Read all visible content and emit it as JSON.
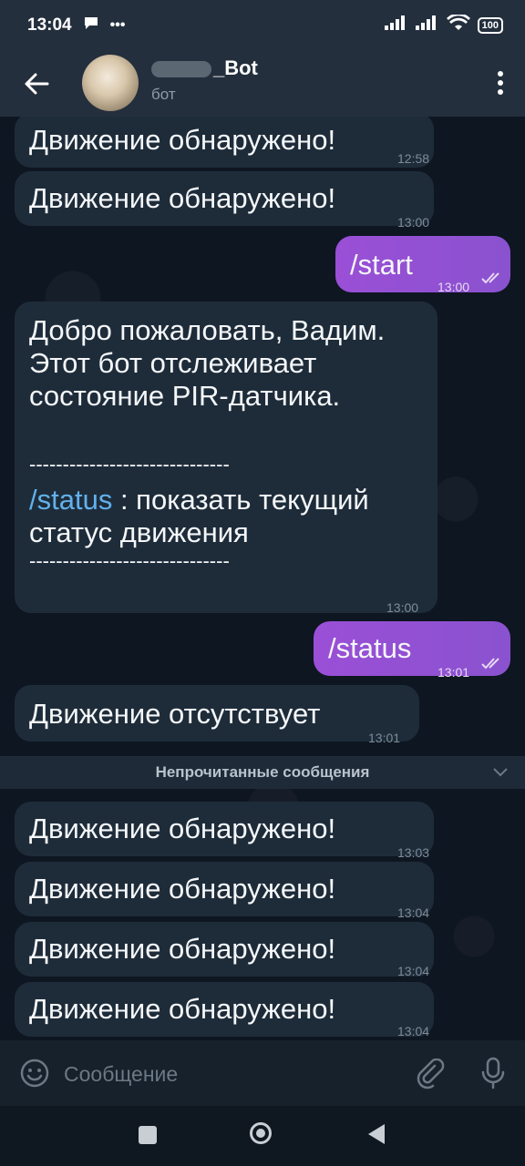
{
  "status_bar": {
    "time": "13:04",
    "battery": "100"
  },
  "header": {
    "title_suffix": "_Bot",
    "subtitle": "бот"
  },
  "messages": [
    {
      "text": "Движение обнаружено!",
      "time": "12:58"
    },
    {
      "text": "Движение обнаружено!",
      "time": "13:00"
    },
    {
      "text": "/start",
      "time": "13:00"
    },
    {
      "line1": "Добро пожаловать, Вадим.",
      "line2": "Этот бот отслеживает",
      "line3": "состояние PIR-датчика.",
      "divider1": "------------------------------",
      "command": "/status",
      "command_desc": " : показать текущий",
      "line4": "статус движения",
      "divider2": "------------------------------",
      "time": "13:00"
    },
    {
      "text": "/status",
      "time": "13:01"
    },
    {
      "text": "Движение отсутствует",
      "time": "13:01"
    },
    {
      "text": "Движение обнаружено!",
      "time": "13:03"
    },
    {
      "text": "Движение обнаружено!",
      "time": "13:04"
    },
    {
      "text": "Движение обнаружено!",
      "time": "13:04"
    },
    {
      "text": "Движение обнаружено!",
      "time": "13:04"
    }
  ],
  "unread_label": "Непрочитанные сообщения",
  "input": {
    "placeholder": "Сообщение"
  },
  "colors": {
    "incoming": "#1e2c3a",
    "outgoing": "#8f4fd0",
    "link": "#62b1ec"
  },
  "icons": [
    "back-arrow-icon",
    "more-vert-icon",
    "emoji-icon",
    "attach-icon",
    "mic-icon",
    "double-check-icon"
  ]
}
